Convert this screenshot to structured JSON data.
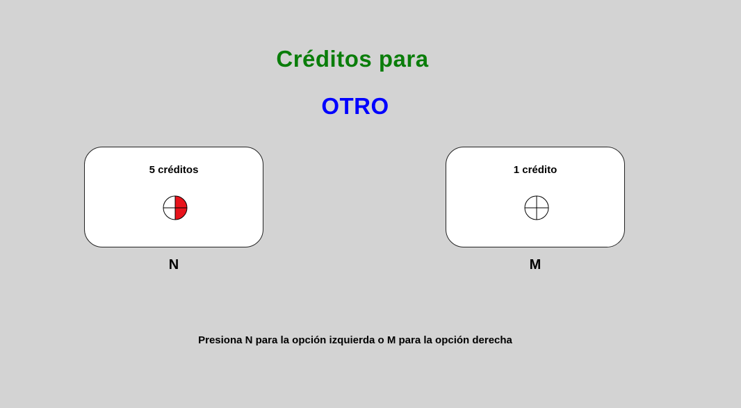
{
  "title": "Créditos para",
  "recipient": "OTRO",
  "options": [
    {
      "label": "5 créditos",
      "key": "N",
      "filled_fraction": 0.5,
      "fill_color": "#e8141c"
    },
    {
      "label": "1 crédito",
      "key": "M",
      "filled_fraction": 0,
      "fill_color": "#e8141c"
    }
  ],
  "instructions": "Presiona N para la opción izquierda o M para la opción derecha",
  "colors": {
    "background": "#d3d3d3",
    "title": "#0a7d0a",
    "recipient": "#0000ff"
  }
}
